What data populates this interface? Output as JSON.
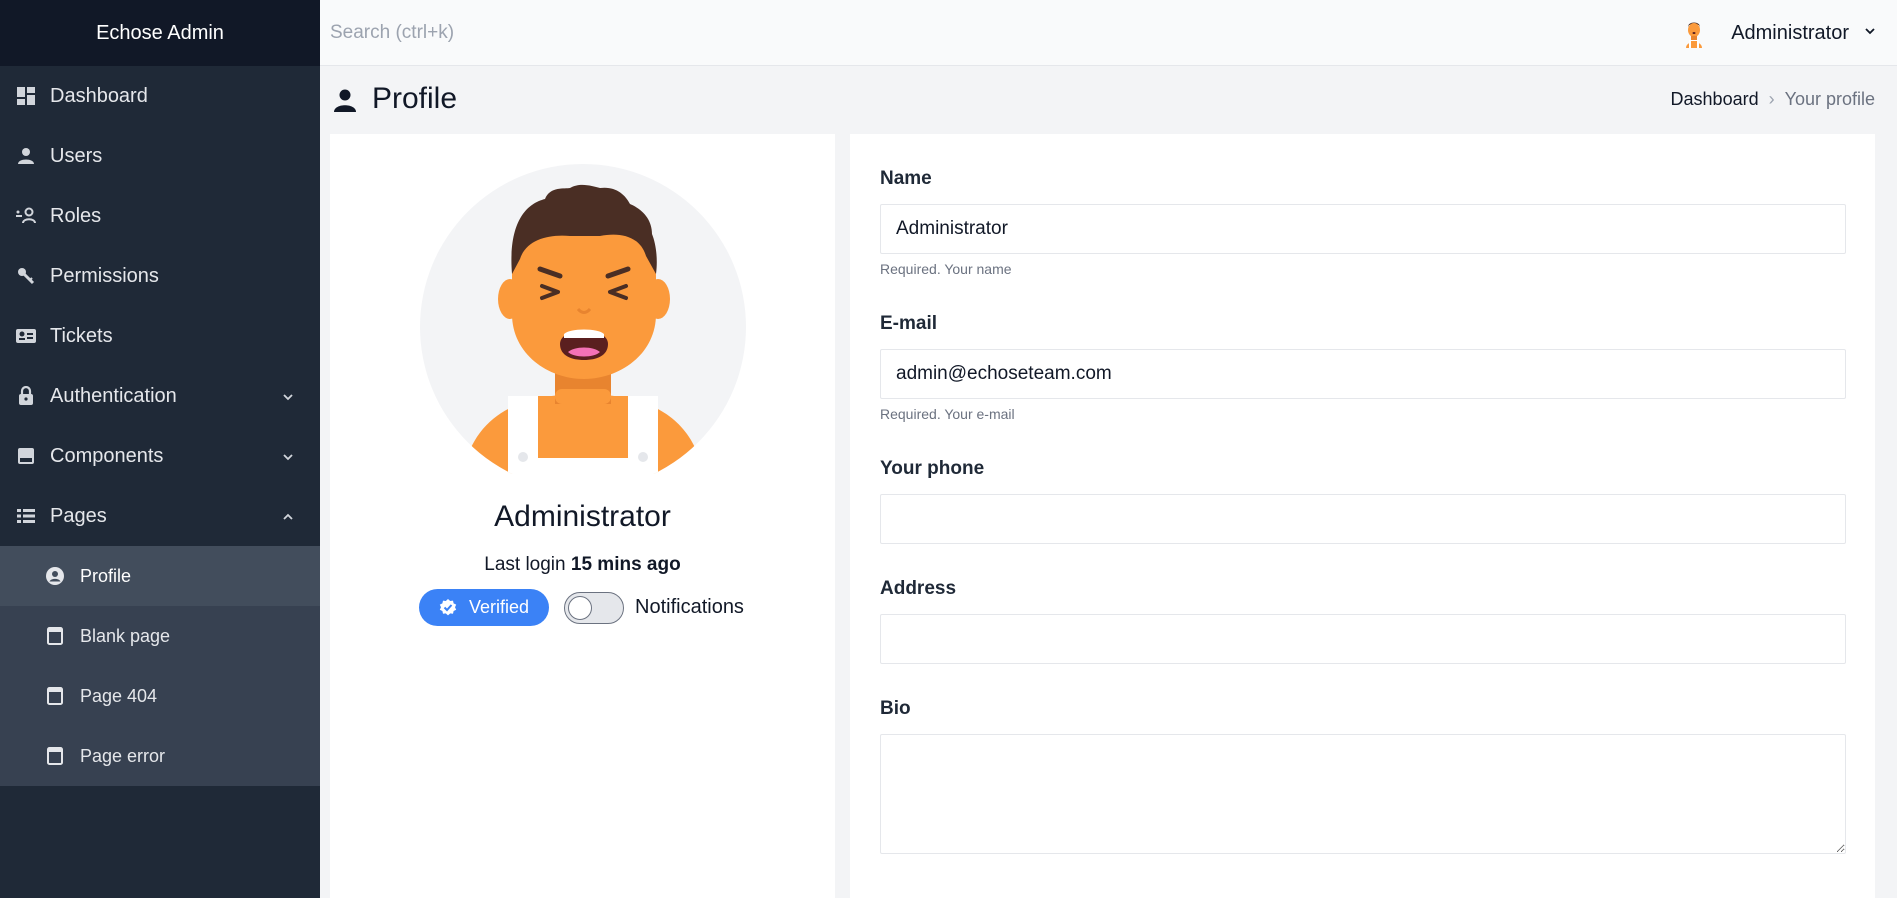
{
  "app": {
    "title": "Echose Admin"
  },
  "sidebar": {
    "items": [
      {
        "label": "Dashboard",
        "icon": "dashboard-icon"
      },
      {
        "label": "Users",
        "icon": "user-icon"
      },
      {
        "label": "Roles",
        "icon": "roles-icon"
      },
      {
        "label": "Permissions",
        "icon": "key-icon"
      },
      {
        "label": "Tickets",
        "icon": "ticket-icon"
      },
      {
        "label": "Authentication",
        "icon": "lock-icon",
        "expanded": false
      },
      {
        "label": "Components",
        "icon": "component-icon",
        "expanded": false
      },
      {
        "label": "Pages",
        "icon": "list-icon",
        "expanded": true
      }
    ],
    "pages_submenu": [
      {
        "label": "Profile",
        "icon": "user-circle-icon",
        "active": true
      },
      {
        "label": "Blank page",
        "icon": "page-icon"
      },
      {
        "label": "Page 404",
        "icon": "page-icon"
      },
      {
        "label": "Page error",
        "icon": "page-icon"
      }
    ]
  },
  "topbar": {
    "search_placeholder": "Search (ctrl+k)",
    "user_name": "Administrator"
  },
  "page": {
    "title": "Profile",
    "breadcrumb": {
      "home": "Dashboard",
      "separator": "›",
      "current": "Your profile"
    }
  },
  "profile": {
    "name": "Administrator",
    "last_login_prefix": "Last login",
    "last_login_value": "15 mins ago",
    "verified_label": "Verified",
    "notifications_label": "Notifications",
    "notifications_on": false
  },
  "form": {
    "name": {
      "label": "Name",
      "value": "Administrator",
      "help": "Required. Your name"
    },
    "email": {
      "label": "E-mail",
      "value": "admin@echoseteam.com",
      "help": "Required. Your e-mail"
    },
    "phone": {
      "label": "Your phone",
      "value": ""
    },
    "address": {
      "label": "Address",
      "value": ""
    },
    "bio": {
      "label": "Bio",
      "value": ""
    }
  },
  "colors": {
    "sidebar_bg": "#1f2937",
    "brand_bg": "#111827",
    "submenu_bg": "#374151",
    "accent": "#3b82f6",
    "avatar_skin": "#fb9a3c"
  }
}
